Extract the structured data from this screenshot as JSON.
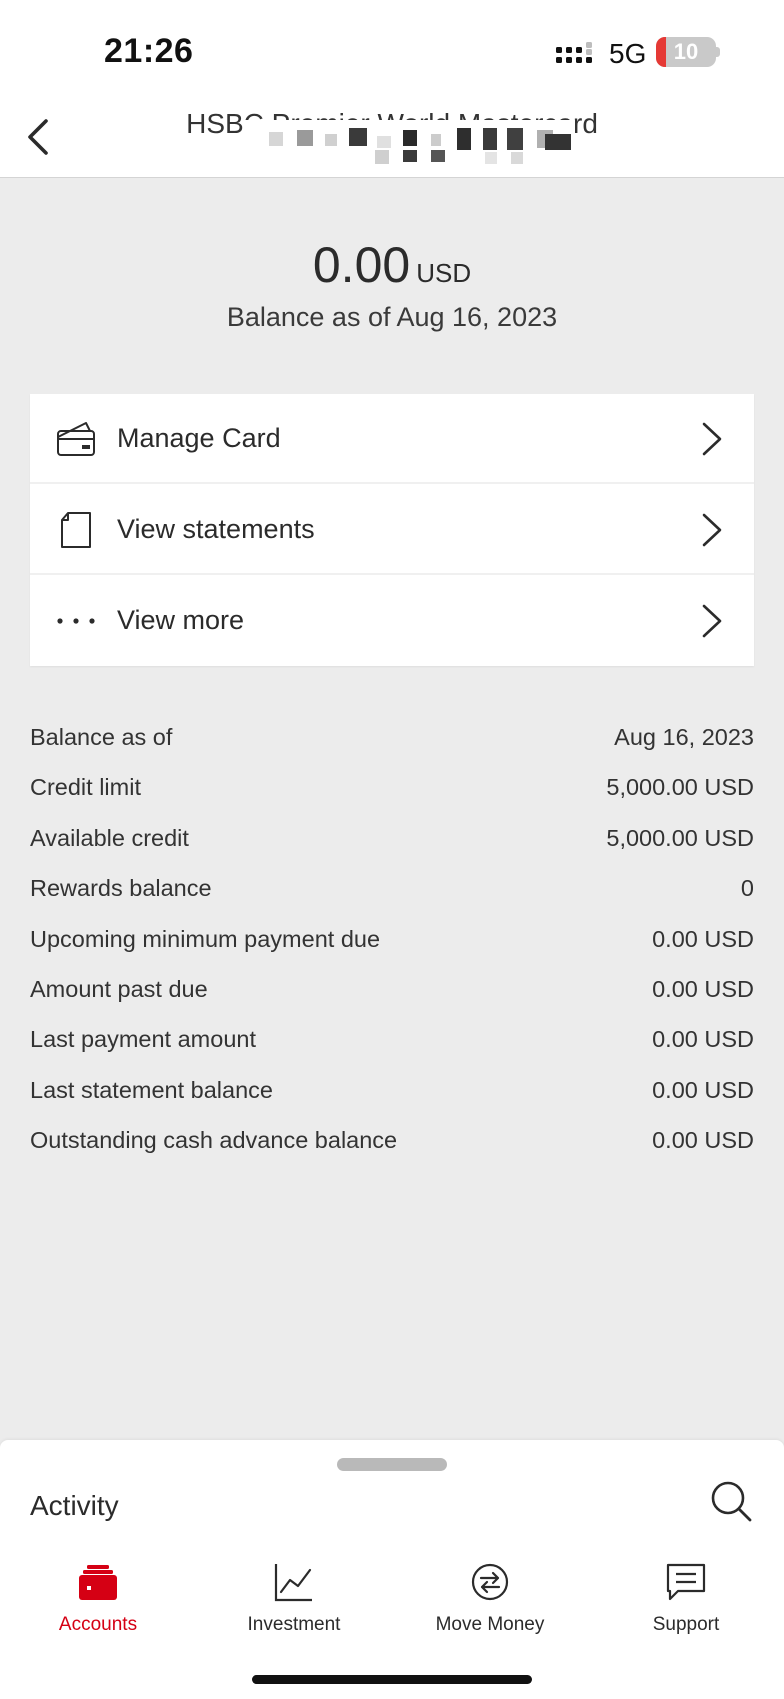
{
  "status_bar": {
    "time": "21:26",
    "network": "5G",
    "battery_level": "10",
    "battery_color": "#e53935"
  },
  "header": {
    "title": "HSBC Premier World Mastercard",
    "back_icon": "chevron-left-icon"
  },
  "balance": {
    "amount": "0.00",
    "currency": "USD",
    "as_of_text": "Balance as of Aug 16, 2023"
  },
  "actions": [
    {
      "label": "Manage Card",
      "icon": "card-icon"
    },
    {
      "label": "View statements",
      "icon": "document-icon"
    },
    {
      "label": "View more",
      "icon": "more-dots-icon"
    }
  ],
  "details": [
    {
      "label": "Balance as of",
      "value": "Aug 16, 2023"
    },
    {
      "label": "Credit limit",
      "value": "5,000.00 USD"
    },
    {
      "label": "Available credit",
      "value": "5,000.00 USD"
    },
    {
      "label": "Rewards balance",
      "value": "0"
    },
    {
      "label": "Upcoming minimum payment due",
      "value": "0.00 USD"
    },
    {
      "label": "Amount past due",
      "value": "0.00 USD"
    },
    {
      "label": "Last payment amount",
      "value": "0.00 USD"
    },
    {
      "label": "Last statement balance",
      "value": "0.00 USD"
    },
    {
      "label": "Outstanding cash advance balance",
      "value": "0.00 USD"
    }
  ],
  "activity": {
    "title": "Activity",
    "search_icon": "search-icon"
  },
  "tabs": [
    {
      "label": "Accounts",
      "icon": "wallet-icon",
      "active": true
    },
    {
      "label": "Investment",
      "icon": "line-chart-icon",
      "active": false
    },
    {
      "label": "Move Money",
      "icon": "transfer-icon",
      "active": false
    },
    {
      "label": "Support",
      "icon": "chat-icon",
      "active": false
    }
  ],
  "colors": {
    "brand_red": "#d50014",
    "background": "#ececec",
    "card": "#ffffff"
  }
}
